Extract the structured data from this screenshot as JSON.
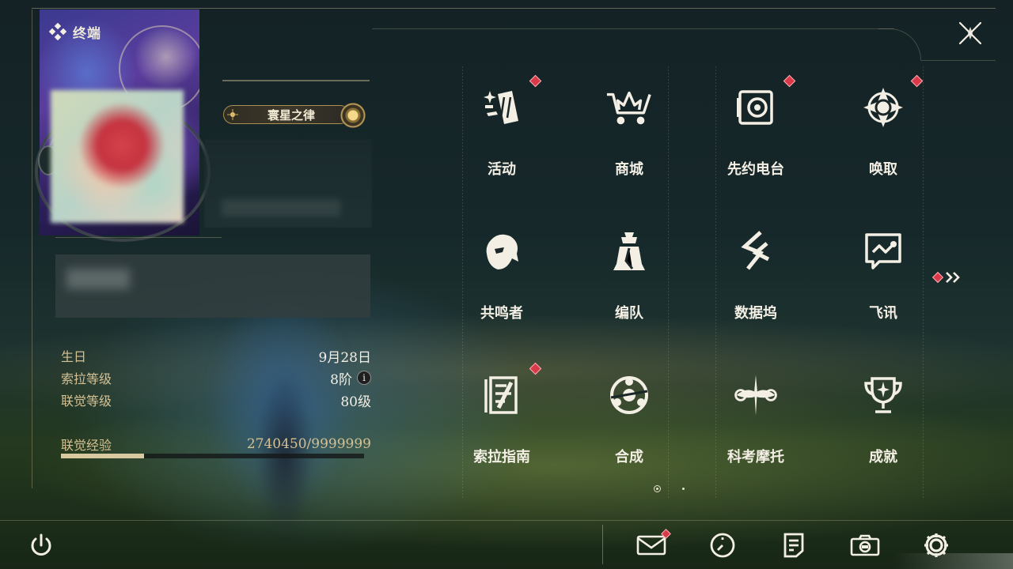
{
  "header": {
    "title": "终端"
  },
  "profile": {
    "rank_title": "寰星之律"
  },
  "stats": [
    {
      "label": "生日",
      "value": "9月28日"
    },
    {
      "label": "索拉等级",
      "value": "8阶"
    },
    {
      "label": "联觉等级",
      "value": "80级"
    }
  ],
  "experience": {
    "label": "联觉经验",
    "value_text": "2740450/9999999",
    "progress": 0.274
  },
  "menu": [
    {
      "label": "活动",
      "icon": "activity-icon",
      "notify": true
    },
    {
      "label": "商城",
      "icon": "shop-icon",
      "notify": false
    },
    {
      "label": "先约电台",
      "icon": "radio-icon",
      "notify": true
    },
    {
      "label": "唤取",
      "icon": "convene-icon",
      "notify": true
    },
    {
      "label": "共鸣者",
      "icon": "resonator-icon",
      "notify": false
    },
    {
      "label": "编队",
      "icon": "team-icon",
      "notify": false
    },
    {
      "label": "数据坞",
      "icon": "data-bank-icon",
      "notify": false
    },
    {
      "label": "飞讯",
      "icon": "message-icon",
      "notify": false
    },
    {
      "label": "索拉指南",
      "icon": "guidebook-icon",
      "notify": true
    },
    {
      "label": "合成",
      "icon": "synthesis-icon",
      "notify": false
    },
    {
      "label": "科考摩托",
      "icon": "motorcycle-icon",
      "notify": false
    },
    {
      "label": "成就",
      "icon": "trophy-icon",
      "notify": false
    }
  ],
  "pagination": {
    "current": 1,
    "total": 2
  },
  "bottom_bar": [
    "power-icon",
    "mail-icon",
    "clock-icon",
    "notes-icon",
    "camera-icon",
    "settings-icon"
  ],
  "colors": {
    "accent_gold": "#d4c194",
    "notify_red": "#d83a4a",
    "text": "#f3efe4"
  }
}
